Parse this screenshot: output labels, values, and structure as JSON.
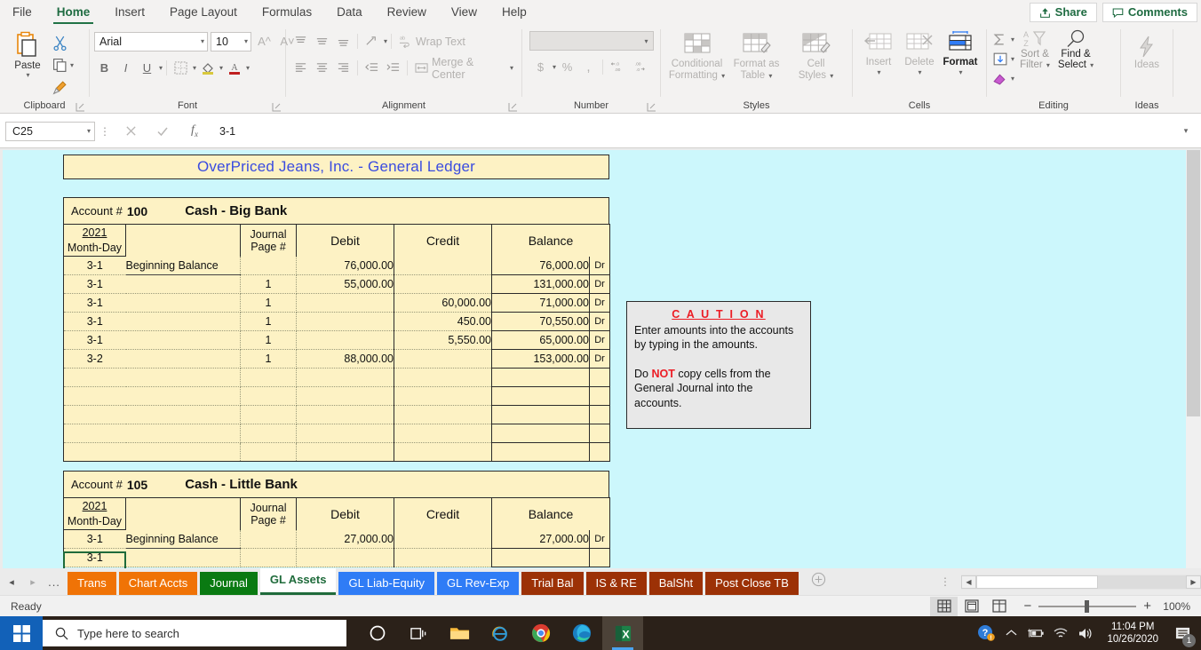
{
  "ribbon": {
    "tabs": [
      {
        "label": "File",
        "active": false
      },
      {
        "label": "Home",
        "active": true
      },
      {
        "label": "Insert",
        "active": false
      },
      {
        "label": "Page Layout",
        "active": false
      },
      {
        "label": "Formulas",
        "active": false
      },
      {
        "label": "Data",
        "active": false
      },
      {
        "label": "Review",
        "active": false
      },
      {
        "label": "View",
        "active": false
      },
      {
        "label": "Help",
        "active": false
      }
    ],
    "share_label": "Share",
    "comments_label": "Comments",
    "groups": {
      "clipboard": {
        "label": "Clipboard",
        "paste": "Paste"
      },
      "font": {
        "label": "Font",
        "font_name": "Arial",
        "font_size": "10",
        "bold": "B",
        "italic": "I",
        "underline": "U"
      },
      "alignment": {
        "label": "Alignment",
        "wrap_text": "Wrap Text",
        "merge_center": "Merge & Center"
      },
      "number": {
        "label": "Number",
        "format": "",
        "currency": "$",
        "percent": "%",
        "comma": "‰"
      },
      "styles": {
        "label": "Styles",
        "conditional_formatting": "Conditional\nFormatting",
        "format_as_table": "Format as\nTable",
        "cell_styles": "Cell\nStyles"
      },
      "cells": {
        "label": "Cells",
        "insert": "Insert",
        "delete": "Delete",
        "format": "Format"
      },
      "editing": {
        "label": "Editing",
        "sort_filter": "Sort &\nFilter",
        "find_select": "Find &\nSelect"
      },
      "ideas": {
        "label": "Ideas",
        "ideas": "Ideas"
      }
    }
  },
  "formula_bar": {
    "name_box": "C25",
    "formula": "3-1"
  },
  "sheet": {
    "title": "OverPriced Jeans, Inc.  -  General Ledger",
    "title_color": "#3a4ce0",
    "background_color": "#ccf7fc",
    "cell_color": "#fdf2c4",
    "caution": {
      "heading": "C A U T I O N",
      "line1": "Enter amounts into the accounts",
      "line2": "by typing in the amounts.",
      "line3_a": "Do ",
      "line3_red": "NOT",
      "line3_b": " copy cells from the",
      "line4": "General Journal into the",
      "line5": "accounts."
    },
    "accounts": [
      {
        "account_label": "Account #",
        "account_number": "100",
        "account_name": "Cash - Big Bank",
        "year": "2021",
        "date_header": "Month-Day",
        "columns": [
          "Journal\nPage #",
          "Debit",
          "Credit",
          "Balance"
        ],
        "col_journal_line1": "Journal",
        "col_journal_line2": "Page #",
        "col_debit": "Debit",
        "col_credit": "Credit",
        "col_balance": "Balance",
        "rows": [
          {
            "date": "3-1",
            "desc": "Beginning Balance",
            "page": "",
            "debit": "76,000.00",
            "credit": "",
            "balance": "76,000.00",
            "dc": "Dr"
          },
          {
            "date": "3-1",
            "desc": "",
            "page": "1",
            "debit": "55,000.00",
            "credit": "",
            "balance": "131,000.00",
            "dc": "Dr"
          },
          {
            "date": "3-1",
            "desc": "",
            "page": "1",
            "debit": "",
            "credit": "60,000.00",
            "balance": "71,000.00",
            "dc": "Dr"
          },
          {
            "date": "3-1",
            "desc": "",
            "page": "1",
            "debit": "",
            "credit": "450.00",
            "balance": "70,550.00",
            "dc": "Dr"
          },
          {
            "date": "3-1",
            "desc": "",
            "page": "1",
            "debit": "",
            "credit": "5,550.00",
            "balance": "65,000.00",
            "dc": "Dr"
          },
          {
            "date": "3-2",
            "desc": "",
            "page": "1",
            "debit": "88,000.00",
            "credit": "",
            "balance": "153,000.00",
            "dc": "Dr"
          },
          {
            "date": "",
            "desc": "",
            "page": "",
            "debit": "",
            "credit": "",
            "balance": "",
            "dc": ""
          },
          {
            "date": "",
            "desc": "",
            "page": "",
            "debit": "",
            "credit": "",
            "balance": "",
            "dc": ""
          },
          {
            "date": "",
            "desc": "",
            "page": "",
            "debit": "",
            "credit": "",
            "balance": "",
            "dc": ""
          },
          {
            "date": "",
            "desc": "",
            "page": "",
            "debit": "",
            "credit": "",
            "balance": "",
            "dc": ""
          },
          {
            "date": "",
            "desc": "",
            "page": "",
            "debit": "",
            "credit": "",
            "balance": "",
            "dc": ""
          }
        ]
      },
      {
        "account_label": "Account #",
        "account_number": "105",
        "account_name": "Cash - Little Bank",
        "year": "2021",
        "date_header": "Month-Day",
        "col_journal_line1": "Journal",
        "col_journal_line2": "Page #",
        "col_debit": "Debit",
        "col_credit": "Credit",
        "col_balance": "Balance",
        "rows": [
          {
            "date": "3-1",
            "desc": "Beginning Balance",
            "page": "",
            "debit": "27,000.00",
            "credit": "",
            "balance": "27,000.00",
            "dc": "Dr"
          },
          {
            "date": "3-1",
            "desc": "",
            "page": "",
            "debit": "",
            "credit": "",
            "balance": "",
            "dc": ""
          }
        ]
      }
    ]
  },
  "sheet_tabs": {
    "nav_prev": "◂",
    "nav_next": "▸",
    "ellipsis": "...",
    "add_label": "+",
    "items": [
      {
        "label": "Trans",
        "color": "#f07306",
        "active": false
      },
      {
        "label": "Chart Accts",
        "color": "#f07306",
        "active": false
      },
      {
        "label": "Journal",
        "color": "#0a7a12",
        "active": false
      },
      {
        "label": "GL Assets",
        "color": "#ffffff",
        "active": true
      },
      {
        "label": "GL Liab-Equity",
        "color": "#2f7cf6",
        "active": false
      },
      {
        "label": "GL Rev-Exp",
        "color": "#2f7cf6",
        "active": false
      },
      {
        "label": "Trial Bal",
        "color": "#9c3106",
        "active": false
      },
      {
        "label": "IS & RE",
        "color": "#9c3106",
        "active": false
      },
      {
        "label": "BalSht",
        "color": "#9c3106",
        "active": false
      },
      {
        "label": "Post Close TB",
        "color": "#9c3106",
        "active": false
      }
    ]
  },
  "status_bar": {
    "mode": "Ready",
    "zoom": "100%"
  },
  "taskbar": {
    "search_placeholder": "Type here to search",
    "time": "11:04 PM",
    "date": "10/26/2020",
    "notification_count": "1"
  }
}
